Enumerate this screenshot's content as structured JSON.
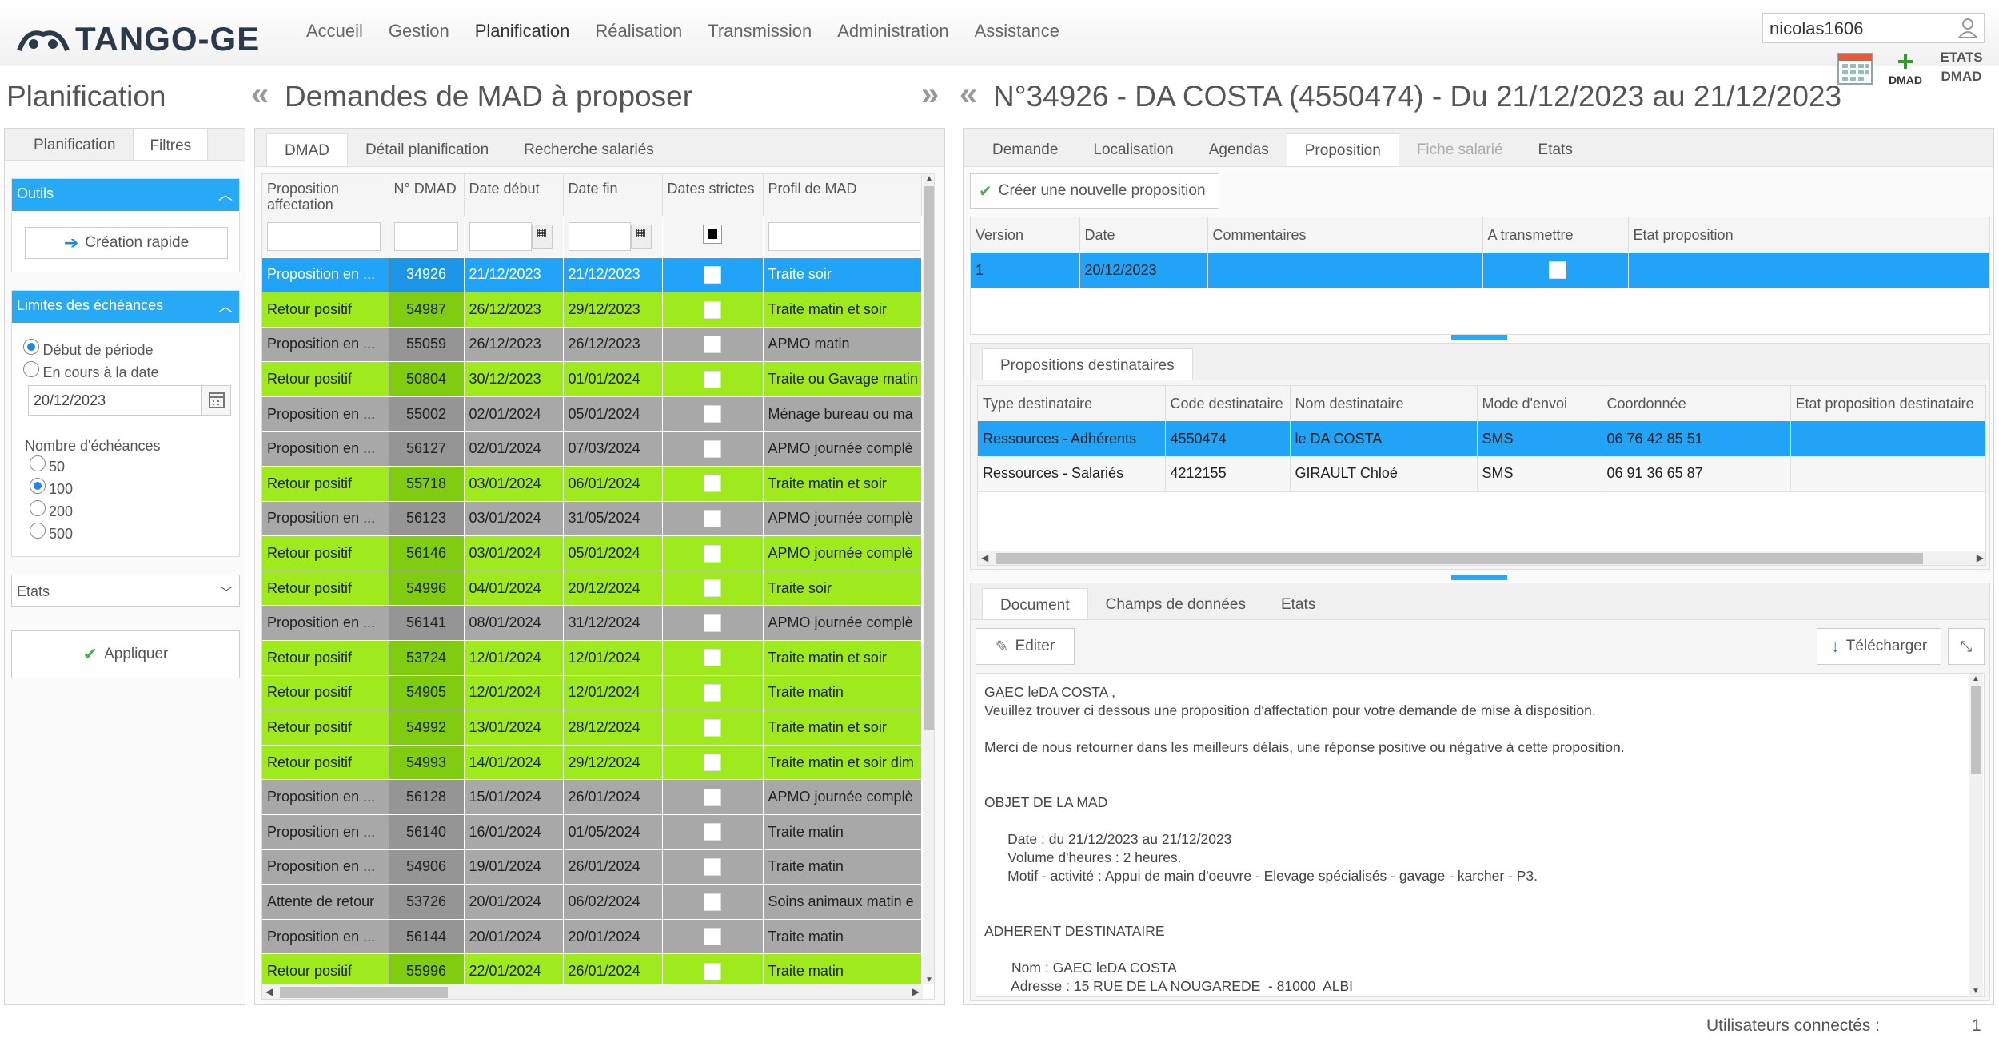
{
  "app": {
    "logo_text": "TANGO-GE"
  },
  "menu": [
    "Accueil",
    "Gestion",
    "Planification",
    "Réalisation",
    "Transmission",
    "Administration",
    "Assistance"
  ],
  "user": {
    "name": "nicolas1606"
  },
  "toolbar": {
    "dmad_label": "DMAD",
    "etats_label": "ETATS\nDMAD"
  },
  "left": {
    "title": "Planification",
    "tabs": [
      "Planification",
      "Filtres"
    ],
    "outils_header": "Outils",
    "creation_rapide": "Création rapide",
    "limites_header": "Limites des échéances",
    "radio_debut": "Début de période",
    "radio_encours": "En cours à la date",
    "date_value": "20/12/2023",
    "nombre_label": "Nombre d'échéances",
    "nombre_options": [
      "50",
      "100",
      "200",
      "500"
    ],
    "nombre_selected": "100",
    "etats_select": "Etats",
    "appliquer": "Appliquer"
  },
  "middle": {
    "title": "Demandes de MAD à proposer",
    "tabs": [
      "DMAD",
      "Détail planification",
      "Recherche salariés"
    ],
    "columns": [
      "Proposition affectation",
      "N° DMAD",
      "Date début",
      "Date fin",
      "Dates strictes",
      "Profil de MAD"
    ],
    "rows": [
      {
        "status": "blue",
        "prop": "Proposition en ...",
        "num": "34926",
        "debut": "21/12/2023",
        "fin": "21/12/2023",
        "profil": "Traite soir"
      },
      {
        "status": "green",
        "prop": "Retour positif",
        "num": "54987",
        "debut": "26/12/2023",
        "fin": "29/12/2023",
        "profil": "Traite matin et soir"
      },
      {
        "status": "gray",
        "prop": "Proposition en ...",
        "num": "55059",
        "debut": "26/12/2023",
        "fin": "26/12/2023",
        "profil": "APMO matin"
      },
      {
        "status": "green",
        "prop": "Retour positif",
        "num": "50804",
        "debut": "30/12/2023",
        "fin": "01/01/2024",
        "profil": "Traite ou Gavage matin"
      },
      {
        "status": "gray",
        "prop": "Proposition en ...",
        "num": "55002",
        "debut": "02/01/2024",
        "fin": "05/01/2024",
        "profil": "Ménage bureau ou ma"
      },
      {
        "status": "gray",
        "prop": "Proposition en ...",
        "num": "56127",
        "debut": "02/01/2024",
        "fin": "07/03/2024",
        "profil": "APMO journée complè"
      },
      {
        "status": "green",
        "prop": "Retour positif",
        "num": "55718",
        "debut": "03/01/2024",
        "fin": "06/01/2024",
        "profil": "Traite matin et soir"
      },
      {
        "status": "gray",
        "prop": "Proposition en ...",
        "num": "56123",
        "debut": "03/01/2024",
        "fin": "31/05/2024",
        "profil": "APMO journée complè"
      },
      {
        "status": "green",
        "prop": "Retour positif",
        "num": "56146",
        "debut": "03/01/2024",
        "fin": "05/01/2024",
        "profil": "APMO journée complè"
      },
      {
        "status": "green",
        "prop": "Retour positif",
        "num": "54996",
        "debut": "04/01/2024",
        "fin": "20/12/2024",
        "profil": "Traite soir"
      },
      {
        "status": "gray",
        "prop": "Proposition en ...",
        "num": "56141",
        "debut": "08/01/2024",
        "fin": "31/12/2024",
        "profil": "APMO journée complè"
      },
      {
        "status": "green",
        "prop": "Retour positif",
        "num": "53724",
        "debut": "12/01/2024",
        "fin": "12/01/2024",
        "profil": "Traite matin et soir"
      },
      {
        "status": "green",
        "prop": "Retour positif",
        "num": "54905",
        "debut": "12/01/2024",
        "fin": "12/01/2024",
        "profil": "Traite matin"
      },
      {
        "status": "green",
        "prop": "Retour positif",
        "num": "54992",
        "debut": "13/01/2024",
        "fin": "28/12/2024",
        "profil": "Traite matin et soir"
      },
      {
        "status": "green",
        "prop": "Retour positif",
        "num": "54993",
        "debut": "14/01/2024",
        "fin": "29/12/2024",
        "profil": "Traite matin et soir dim"
      },
      {
        "status": "gray",
        "prop": "Proposition en ...",
        "num": "56128",
        "debut": "15/01/2024",
        "fin": "26/01/2024",
        "profil": "APMO journée complè"
      },
      {
        "status": "gray",
        "prop": "Proposition en ...",
        "num": "56140",
        "debut": "16/01/2024",
        "fin": "01/05/2024",
        "profil": "Traite matin"
      },
      {
        "status": "gray",
        "prop": "Proposition en ...",
        "num": "54906",
        "debut": "19/01/2024",
        "fin": "26/01/2024",
        "profil": "Traite matin"
      },
      {
        "status": "gray",
        "prop": "Attente de retour",
        "num": "53726",
        "debut": "20/01/2024",
        "fin": "06/02/2024",
        "profil": "Soins animaux matin e"
      },
      {
        "status": "gray",
        "prop": "Proposition en ...",
        "num": "56144",
        "debut": "20/01/2024",
        "fin": "20/01/2024",
        "profil": "Traite matin"
      },
      {
        "status": "green",
        "prop": "Retour positif",
        "num": "55996",
        "debut": "22/01/2024",
        "fin": "26/01/2024",
        "profil": "Traite matin"
      }
    ]
  },
  "right": {
    "title": "N°34926 - DA COSTA (4550474) - Du 21/12/2023 au 21/12/2023",
    "tabs": [
      "Demande",
      "Localisation",
      "Agendas",
      "Proposition",
      "Fiche salarié",
      "Etats"
    ],
    "create_btn": "Créer une nouvelle proposition",
    "prop_columns": [
      "Version",
      "Date",
      "Commentaires",
      "A transmettre",
      "Etat proposition"
    ],
    "prop_rows": [
      {
        "version": "1",
        "date": "20/12/2023",
        "comment": "",
        "etat": ""
      }
    ],
    "dest_tab": "Propositions destinataires",
    "dest_columns": [
      "Type destinataire",
      "Code destinataire",
      "Nom destinataire",
      "Mode d'envoi",
      "Coordonnée",
      "Etat proposition destinataire"
    ],
    "dest_rows": [
      {
        "type": "Ressources - Adhérents",
        "code": "4550474",
        "nom": "le DA COSTA",
        "mode": "SMS",
        "coord": "06 76 42 85 51",
        "etat": ""
      },
      {
        "type": "Ressources - Salariés",
        "code": "4212155",
        "nom": "GIRAULT Chloé",
        "mode": "SMS",
        "coord": "06 91 36 65 87",
        "etat": ""
      }
    ],
    "doc_tabs": [
      "Document",
      "Champs de données",
      "Etats"
    ],
    "editer": "Editer",
    "telecharger": "Télécharger",
    "doc_lines": [
      "GAEC leDA COSTA ,",
      "Veuillez trouver ci dessous une proposition d'affectation pour votre demande de mise à disposition.",
      "",
      "Merci de nous retourner dans les meilleurs délais, une réponse positive ou négative à cette proposition.",
      "",
      "",
      "OBJET DE LA MAD",
      "",
      "      Date : du 21/12/2023 au 21/12/2023",
      "      Volume d'heures : 2 heures.",
      "      Motif - activité : Appui de main d'oeuvre - Elevage spécialisés - gavage - karcher - P3.",
      "",
      "",
      "ADHERENT DESTINATAIRE",
      "",
      "       Nom : GAEC leDA COSTA",
      "       Adresse : 15 RUE DE LA NOUGAREDE  - 81000  ALBI"
    ]
  },
  "footer": {
    "label": "Utilisateurs connectés :",
    "count": "1"
  },
  "colors": {
    "accent": "#28a9f5",
    "green": "#9eea1c",
    "gray": "#a8a8a8",
    "selected": "#21a3f7"
  }
}
